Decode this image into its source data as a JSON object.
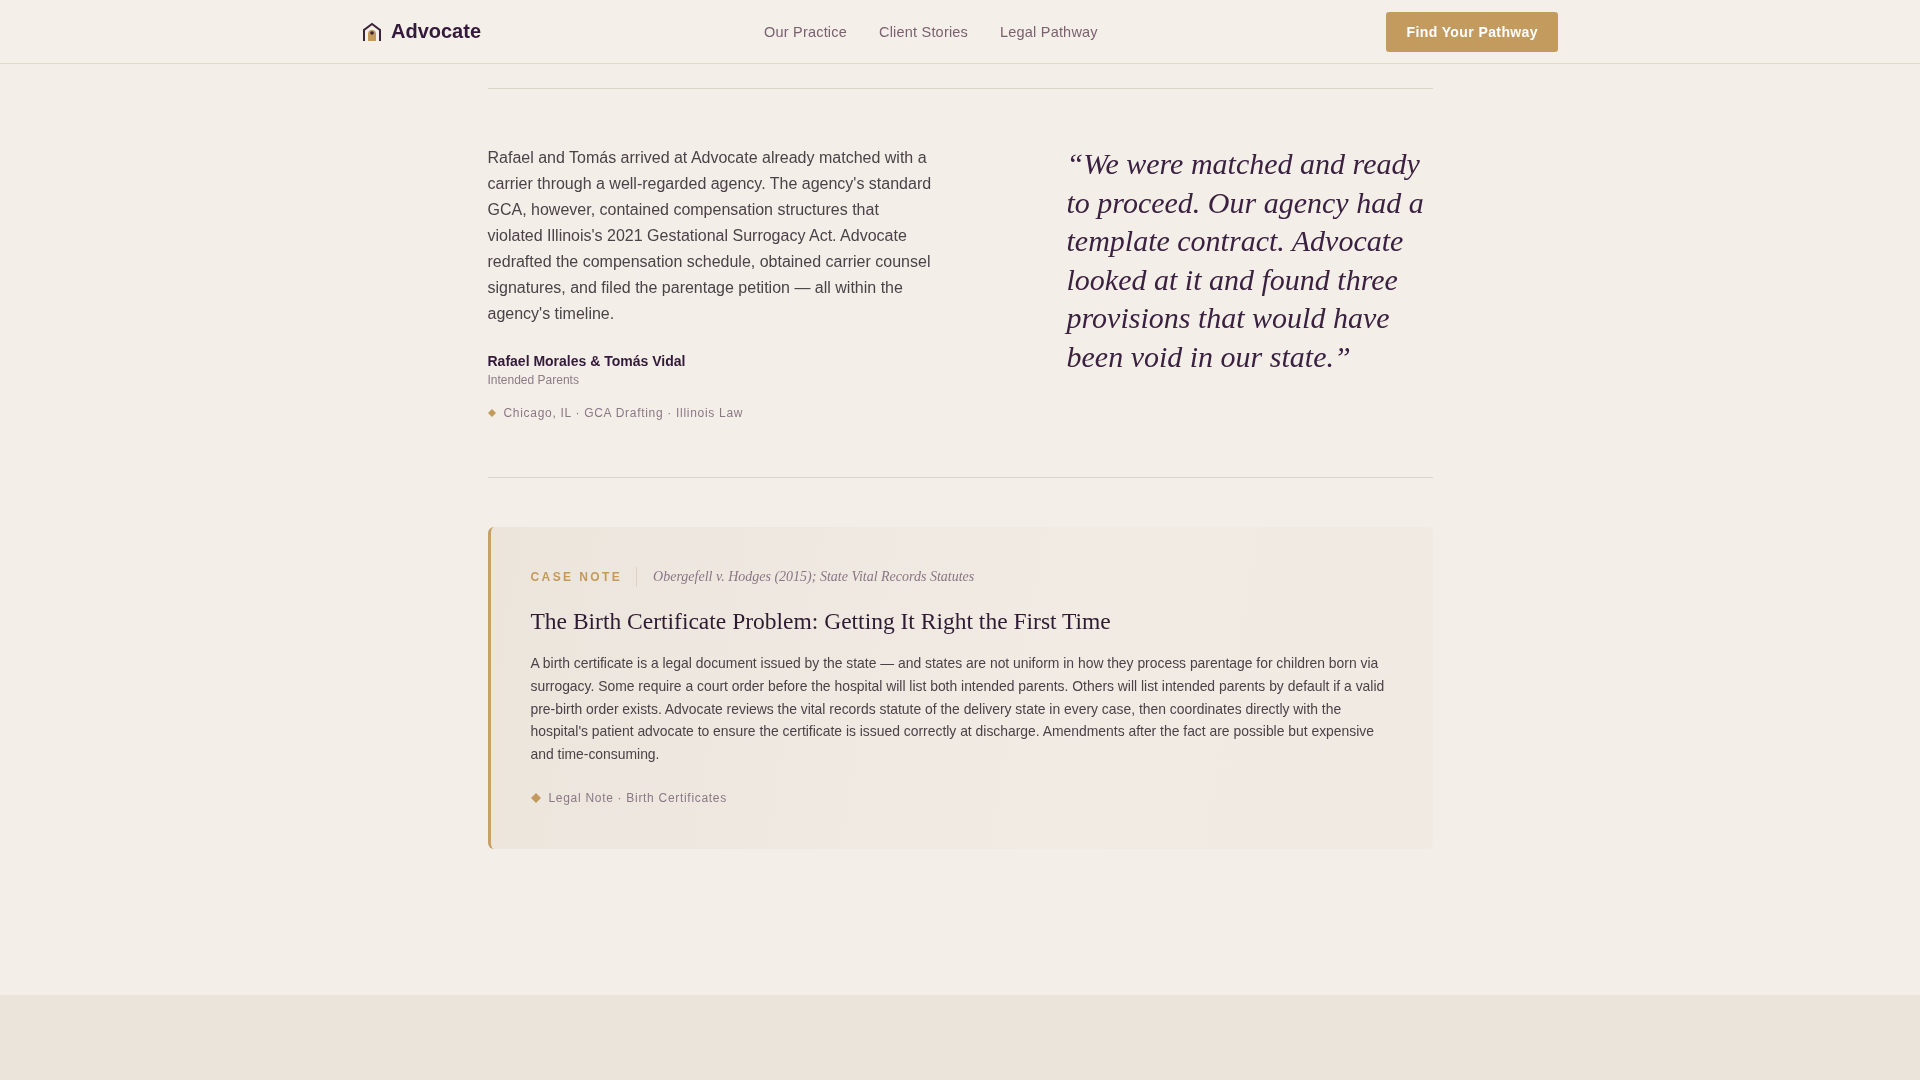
{
  "header": {
    "brand": "Advocate",
    "nav": [
      "Our Practice",
      "Client Stories",
      "Legal Pathway"
    ],
    "cta": "Find Your Pathway"
  },
  "story": {
    "body": "Rafael and Tomás arrived at Advocate already matched with a carrier through a well-regarded agency. The agency's standard GCA, however, contained compensation structures that violated Illinois's 2021 Gestational Surrogacy Act. Advocate redrafted the compensation schedule, obtained carrier counsel signatures, and filed the parentage petition — all within the agency's timeline.",
    "name": "Rafael Morales & Tomás Vidal",
    "role": "Intended Parents",
    "tags": "Chicago, IL · GCA Drafting · Illinois Law",
    "quote": "“We were matched and ready to proceed. Our agency had a template contract. Advocate looked at it and found three provisions that would have been void in our state.”"
  },
  "case_note": {
    "label": "CASE NOTE",
    "citation": "Obergefell v. Hodges (2015); State Vital Records Statutes",
    "title": "The Birth Certificate Problem: Getting It Right the First Time",
    "body": "A birth certificate is a legal document issued by the state — and states are not uniform in how they process parentage for children born via surrogacy. Some require a court order before the hospital will list both intended parents. Others will list intended parents by default if a valid pre-birth order exists. Advocate reviews the vital records statute of the delivery state in every case, then coordinates directly with the hospital's patient advocate to ensure the certificate is issued correctly at discharge. Amendments after the fact are possible but expensive and time-consuming.",
    "tags": "Legal Note · Birth Certificates"
  }
}
